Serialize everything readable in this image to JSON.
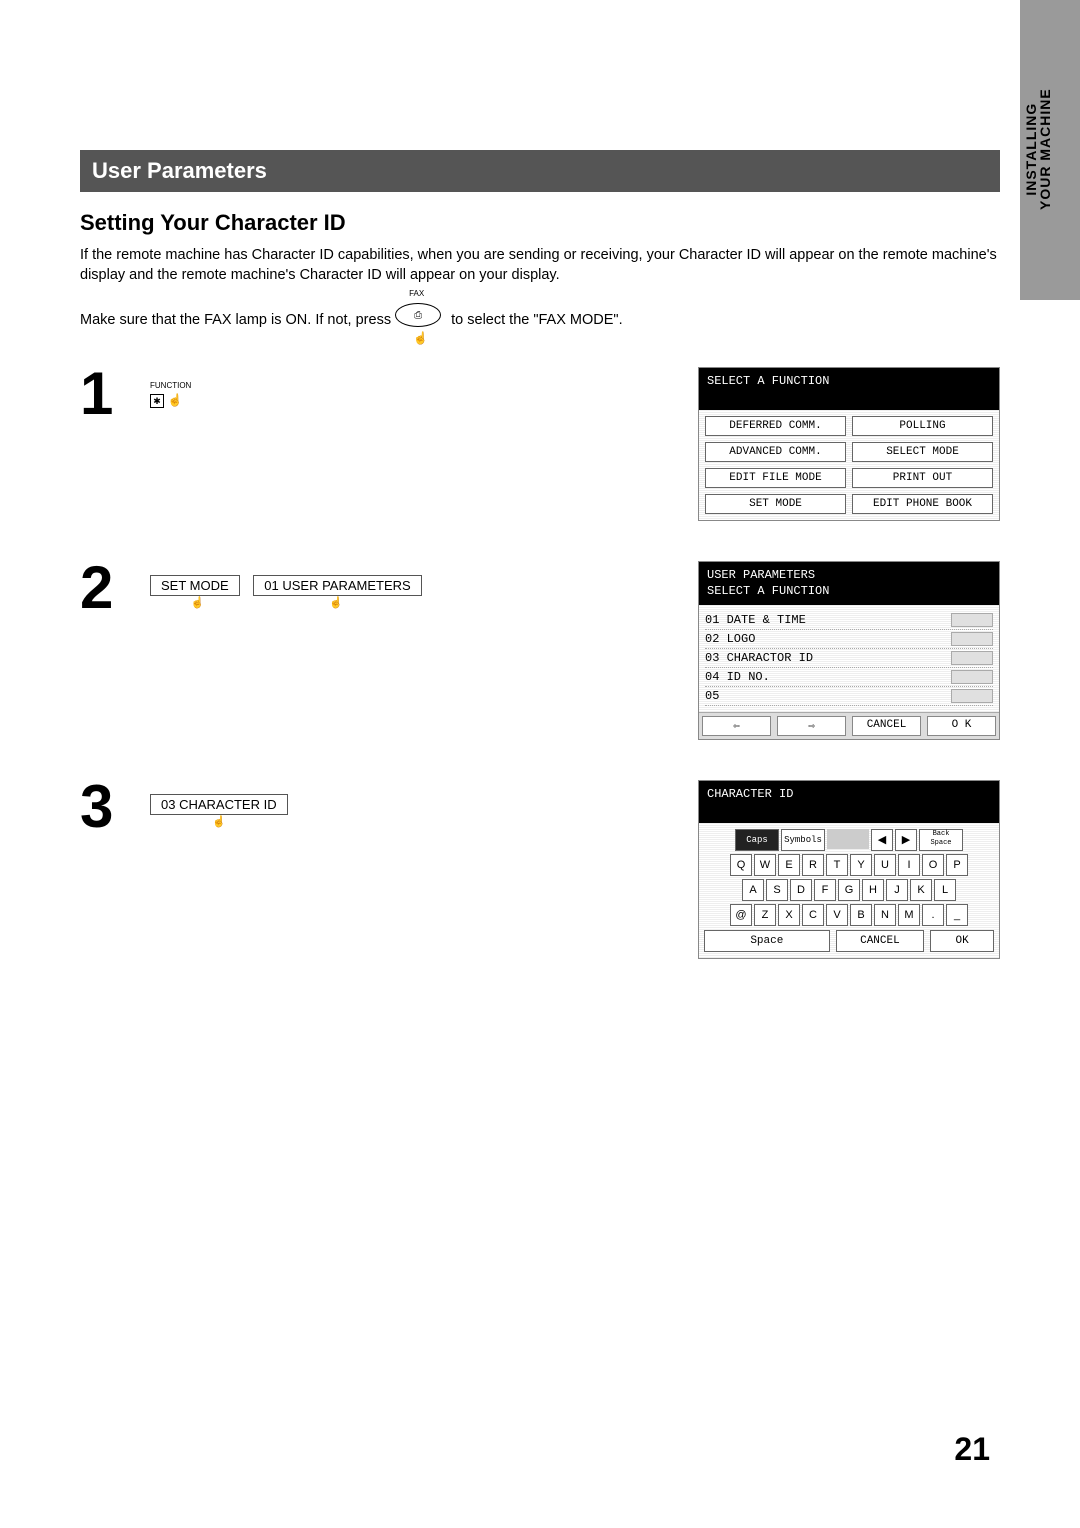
{
  "side_tab": {
    "line1": "INSTALLING",
    "line2": "YOUR MACHINE"
  },
  "page_number": "21",
  "title_bar": "User Parameters",
  "subtitle": "Setting Your Character ID",
  "intro": "If the remote machine has Character ID capabilities, when you are sending or receiving, your Character ID will appear on the remote machine's display and the remote machine's Character ID will appear on your display.",
  "fax_line_pre": "Make sure that the FAX lamp is ON.  If not, press",
  "fax_line_post": " to select the \"FAX MODE\".",
  "fax_button_label": "FAX",
  "steps": {
    "s1": {
      "num": "1",
      "function_label": "FUNCTION",
      "screen_title": "SELECT A FUNCTION",
      "buttons": [
        [
          "DEFERRED COMM.",
          "POLLING"
        ],
        [
          "ADVANCED COMM.",
          "SELECT MODE"
        ],
        [
          "EDIT FILE MODE",
          "PRINT OUT"
        ],
        [
          "SET MODE",
          "EDIT PHONE BOOK"
        ]
      ]
    },
    "s2": {
      "num": "2",
      "btn1": "SET MODE",
      "btn2": "01  USER PARAMETERS",
      "screen_title1": "USER PARAMETERS",
      "screen_title2": "SELECT A FUNCTION",
      "items": [
        "01 DATE & TIME",
        "02 LOGO",
        "03 CHARACTOR ID",
        "04 ID NO.",
        "05"
      ],
      "footer": {
        "prev": "⇦",
        "next": "⇨",
        "cancel": "CANCEL",
        "ok": "O K"
      }
    },
    "s3": {
      "num": "3",
      "btn1": "03 CHARACTER ID",
      "screen_title": "CHARACTER ID",
      "toprow": {
        "caps": "Caps",
        "symbols": "Symbols",
        "left": "◀",
        "right": "▶",
        "back": "Back\nSpace"
      },
      "row1": [
        "Q",
        "W",
        "E",
        "R",
        "T",
        "Y",
        "U",
        "I",
        "O",
        "P"
      ],
      "row2": [
        "A",
        "S",
        "D",
        "F",
        "G",
        "H",
        "J",
        "K",
        "L"
      ],
      "row3": [
        "@",
        "Z",
        "X",
        "C",
        "V",
        "B",
        "N",
        "M",
        ".",
        "_"
      ],
      "bottom": {
        "space": "Space",
        "cancel": "CANCEL",
        "ok": "OK"
      }
    }
  }
}
